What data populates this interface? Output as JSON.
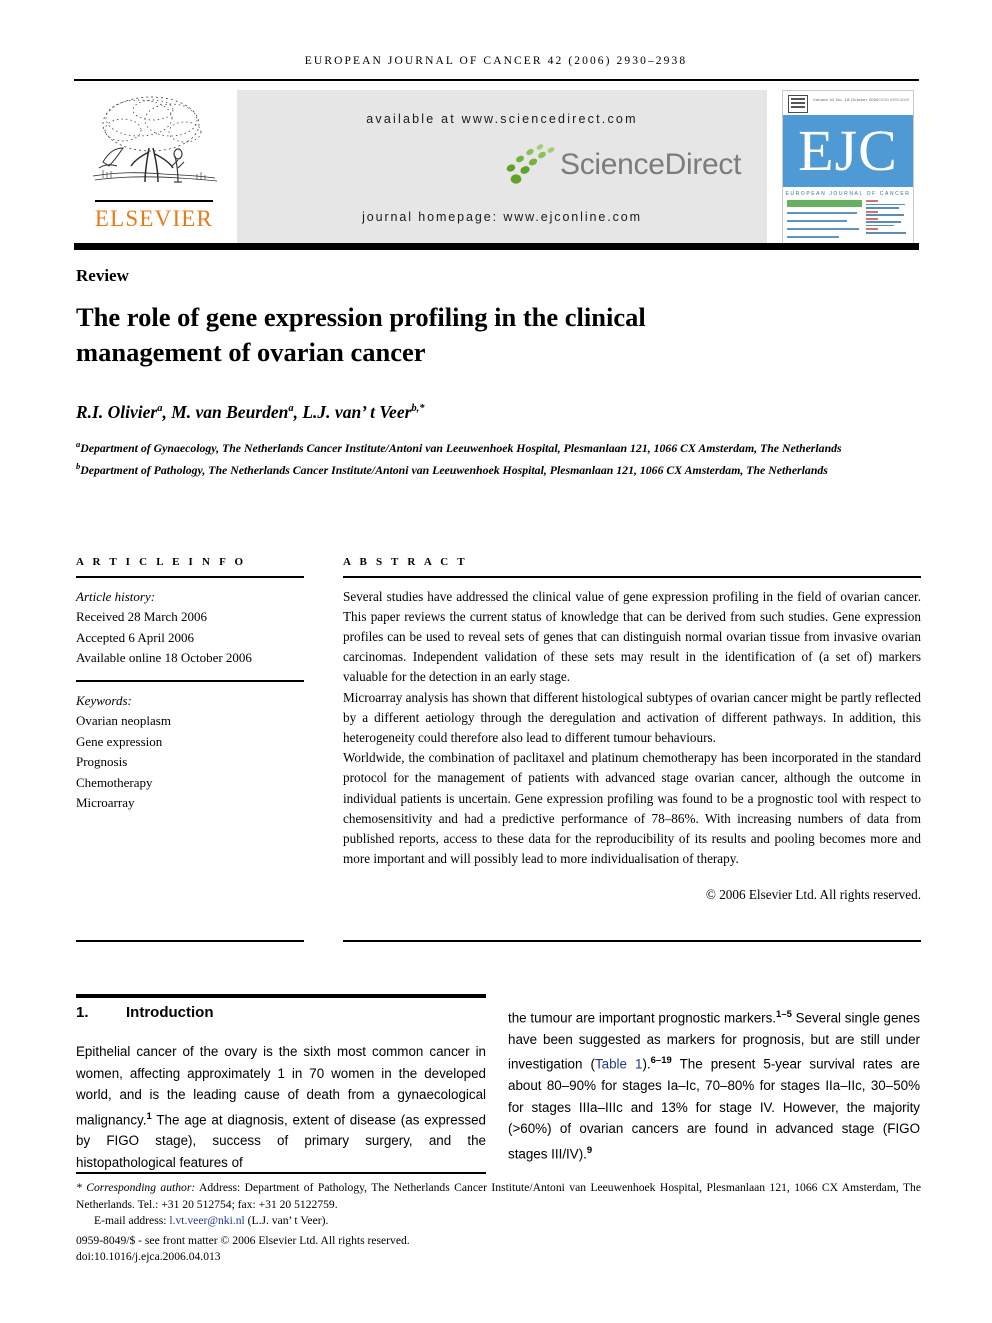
{
  "running_head": "EUROPEAN JOURNAL OF CANCER 42 (2006) 2930–2938",
  "banner": {
    "publisher_name": "ELSEVIER",
    "available_at": "available at www.sciencedirect.com",
    "sciencedirect_word": "ScienceDirect",
    "journal_homepage": "journal homepage: www.ejconline.com",
    "cover": {
      "ejc_letters": "EJC",
      "journal_name": "EUROPEAN JOURNAL OF CANCER",
      "volume_line": "Volume 42  No. 18  October 2006",
      "issn_line": "ISSN 0959-8049",
      "blue_hex": "#4f9ad4",
      "green_hex": "#66b15f"
    },
    "colors": {
      "elsevier_orange": "#E87B18",
      "panel_grey": "#e6e6e6",
      "sciencedirect_green": "#5fa22a",
      "sciencedirect_grey": "#7c7c7c"
    }
  },
  "article": {
    "type_label": "Review",
    "title": "The role of gene expression profiling in the clinical management of ovarian cancer",
    "authors_html": "R.I. Olivier<sup>a</sup>, M. van Beurden<sup>a</sup>, L.J. van&rsquo; t Veer<sup>b,*</sup>",
    "affiliation_a": "Department of Gynaecology, The Netherlands Cancer Institute/Antoni van Leeuwenhoek Hospital, Plesmanlaan 121, 1066 CX Amsterdam, The Netherlands",
    "affiliation_b": "Department of Pathology, The Netherlands Cancer Institute/Antoni van Leeuwenhoek Hospital, Plesmanlaan 121, 1066 CX Amsterdam, The Netherlands"
  },
  "article_info": {
    "heading": "A R T I C L E   I N F O",
    "history_label": "Article history:",
    "history": [
      "Received 28 March 2006",
      "Accepted 6 April 2006",
      "Available online 18 October 2006"
    ],
    "keywords_label": "Keywords:",
    "keywords": [
      "Ovarian neoplasm",
      "Gene expression",
      "Prognosis",
      "Chemotherapy",
      "Microarray"
    ]
  },
  "abstract": {
    "heading": "A B S T R A C T",
    "paragraphs": [
      "Several studies have addressed the clinical value of gene expression profiling in the field of ovarian cancer. This paper reviews the current status of knowledge that can be derived from such studies. Gene expression profiles can be used to reveal sets of genes that can distinguish normal ovarian tissue from invasive ovarian carcinomas. Independent validation of these sets may result in the identification of (a set of) markers valuable for the detection in an early stage.",
      "Microarray analysis has shown that different histological subtypes of ovarian cancer might be partly reflected by a different aetiology through the deregulation and activation of different pathways. In addition, this heterogeneity could therefore also lead to different tumour behaviours.",
      "Worldwide, the combination of paclitaxel and platinum chemotherapy has been incorporated in the standard protocol for the management of patients with advanced stage ovarian cancer, although the outcome in individual patients is uncertain. Gene expression profiling was found to be a prognostic tool with respect to chemosensitivity and had a predictive performance of 78–86%. With increasing numbers of data from published reports, access to these data for the reproducibility of its results and pooling becomes more and more important and will possibly lead to more individualisation of therapy."
    ],
    "copyright": "© 2006 Elsevier Ltd. All rights reserved."
  },
  "introduction": {
    "number": "1.",
    "heading": "Introduction",
    "left_column_html": "Epithelial cancer of the ovary is the sixth most common cancer in women, affecting approximately 1 in 70 women in the developed world, and is the leading cause of death from a gynaecological malignancy.<sup>1</sup> The age at diagnosis, extent of disease (as expressed by FIGO stage), success of primary surgery, and the histopathological features of",
    "right_column_html": "the tumour are important prognostic markers.<sup>1&ndash;5</sup> Several single genes have been suggested as markers for prognosis, but are still under investigation (<span class=\"link\">Table 1</span>).<sup>6&ndash;19</sup> The present 5-year survival rates are about 80&ndash;90% for stages Ia&ndash;Ic, 70&ndash;80% for stages IIa&ndash;IIc, 30&ndash;50% for stages IIIa&ndash;IIIc and 13% for stage IV. However, the majority (&gt;60%) of ovarian cancers are found in advanced stage (FIGO stages III/IV).<sup>9</sup>"
  },
  "footer": {
    "corresponding_html": "<span class=\"corr\">* Corresponding author:</span> Address: Department of Pathology, The Netherlands Cancer Institute/Antoni van Leeuwenhoek Hospital, Plesmanlaan 121, 1066 CX Amsterdam, The Netherlands. Tel.: +31 20 512754; fax: +31 20 5122759.",
    "email_html": "E-mail address: <span class=\"link\">l.vt.veer@nki.nl</span> (L.J. van&rsquo; t Veer).",
    "issn_line": "0959-8049/$ - see front matter © 2006 Elsevier Ltd. All rights reserved.",
    "doi_line": "doi:10.1016/j.ejca.2006.04.013"
  }
}
